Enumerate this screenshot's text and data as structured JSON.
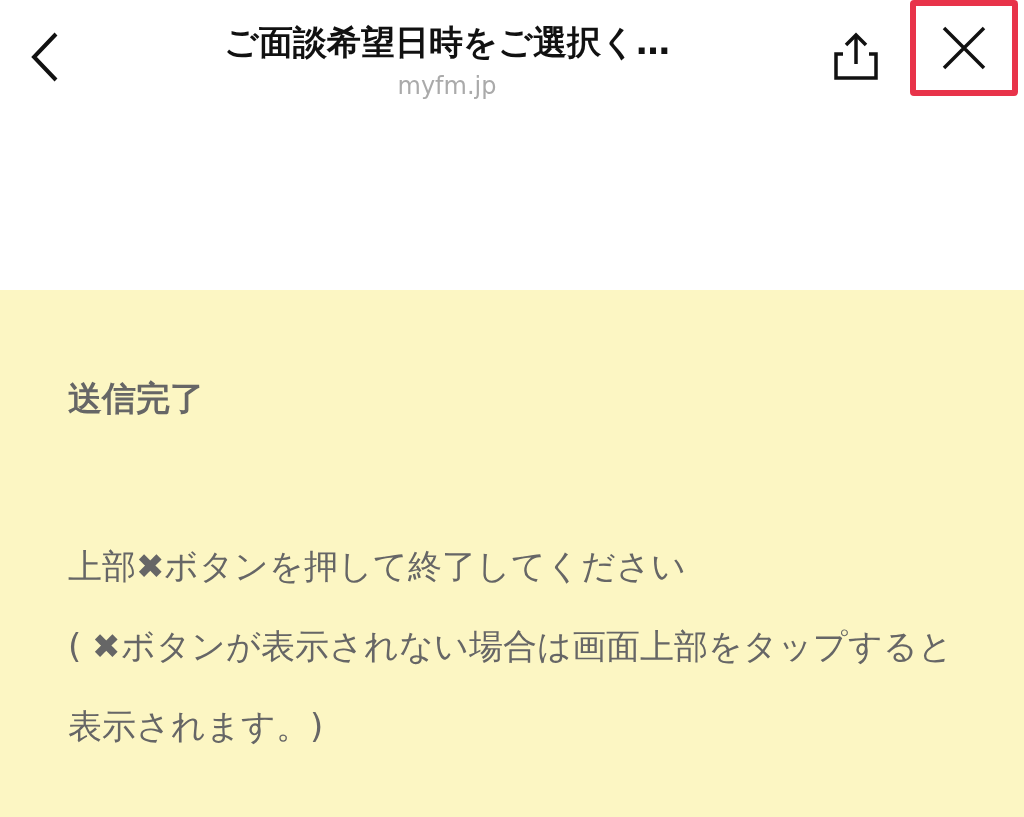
{
  "header": {
    "title": "ご面談希望日時をご選択く…",
    "url": "myfm.jp",
    "close_button": {
      "highlighted": true
    }
  },
  "message": {
    "heading": "送信完了",
    "paragraphs": [
      "上部✖ボタンを押して終了してください",
      "( ✖ボタンが表示されない場合は画面上部をタップすると表示されます。)"
    ]
  }
}
